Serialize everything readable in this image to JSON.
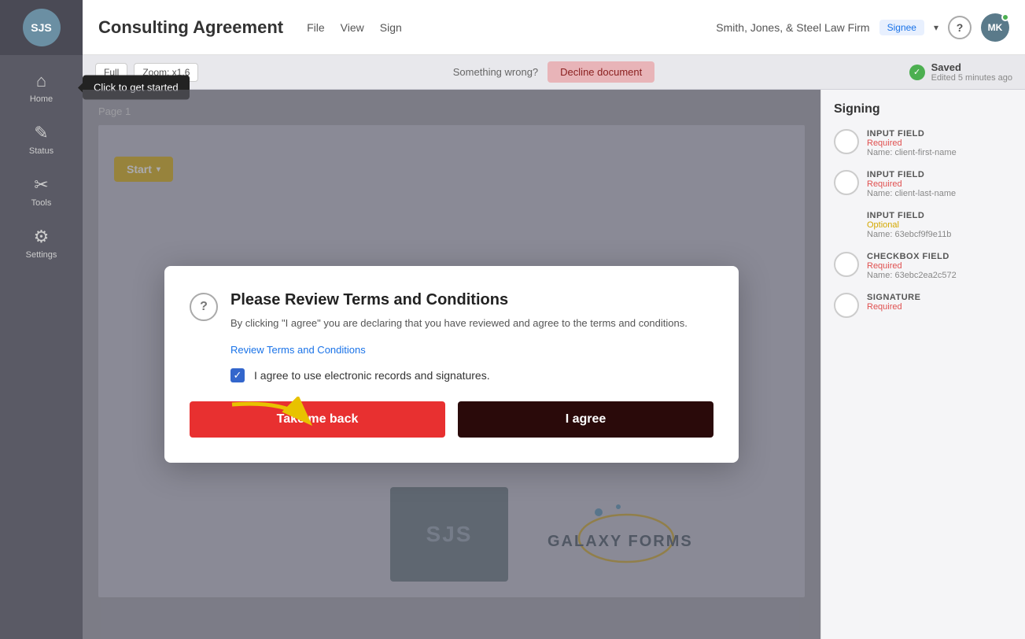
{
  "sidebar": {
    "logo_text": "SJS",
    "items": [
      {
        "id": "home",
        "label": "Home",
        "icon": "⌂",
        "active": false
      },
      {
        "id": "status",
        "label": "Status",
        "icon": "✎",
        "active": false
      },
      {
        "id": "tools",
        "label": "Tools",
        "icon": "✂",
        "active": false
      },
      {
        "id": "settings",
        "label": "Settings",
        "icon": "⚙",
        "active": false
      }
    ],
    "tooltip": "Click to get started"
  },
  "header": {
    "doc_title": "Consulting Agreement",
    "nav": [
      "File",
      "View",
      "Sign"
    ],
    "law_firm": "Smith, Jones, & Steel Law Firm",
    "role_badge": "Signee",
    "help_label": "?",
    "avatar_initials": "MK"
  },
  "toolbar": {
    "full_label": "Full",
    "zoom_label": "Zoom: x1.6",
    "wrong_text": "Something wrong?",
    "decline_label": "Decline document",
    "saved_label": "Saved",
    "saved_sub": "Edited 5 minutes ago"
  },
  "document": {
    "page_label": "Page 1",
    "start_btn": "Start"
  },
  "signing_panel": {
    "title": "Signing",
    "fields": [
      {
        "type": "INPUT FIELD",
        "status": "Required",
        "status_type": "required",
        "name": "Name: client-first-name",
        "has_circle": true
      },
      {
        "type": "INPUT FIELD",
        "status": "Required",
        "status_type": "required",
        "name": "Name: client-last-name",
        "has_circle": true
      },
      {
        "type": "INPUT FIELD",
        "status": "Optional",
        "status_type": "optional",
        "name": "Name: 63ebcf9f9e11b",
        "has_circle": false
      },
      {
        "type": "CHECKBOX FIELD",
        "status": "Required",
        "status_type": "required",
        "name": "Name: 63ebc2ea2c572",
        "has_circle": true
      },
      {
        "type": "SIGNATURE",
        "status": "Required",
        "status_type": "required",
        "name": "",
        "has_circle": true
      }
    ]
  },
  "modal": {
    "icon": "?",
    "title": "Please Review Terms and Conditions",
    "description": "By clicking \"I agree\" you are declaring that you have reviewed and agree to the terms and conditions.",
    "review_link": "Review Terms and Conditions",
    "checkbox_label": "I agree to use electronic records and signatures.",
    "checkbox_checked": true,
    "btn_back": "Take me back",
    "btn_agree": "I agree"
  }
}
